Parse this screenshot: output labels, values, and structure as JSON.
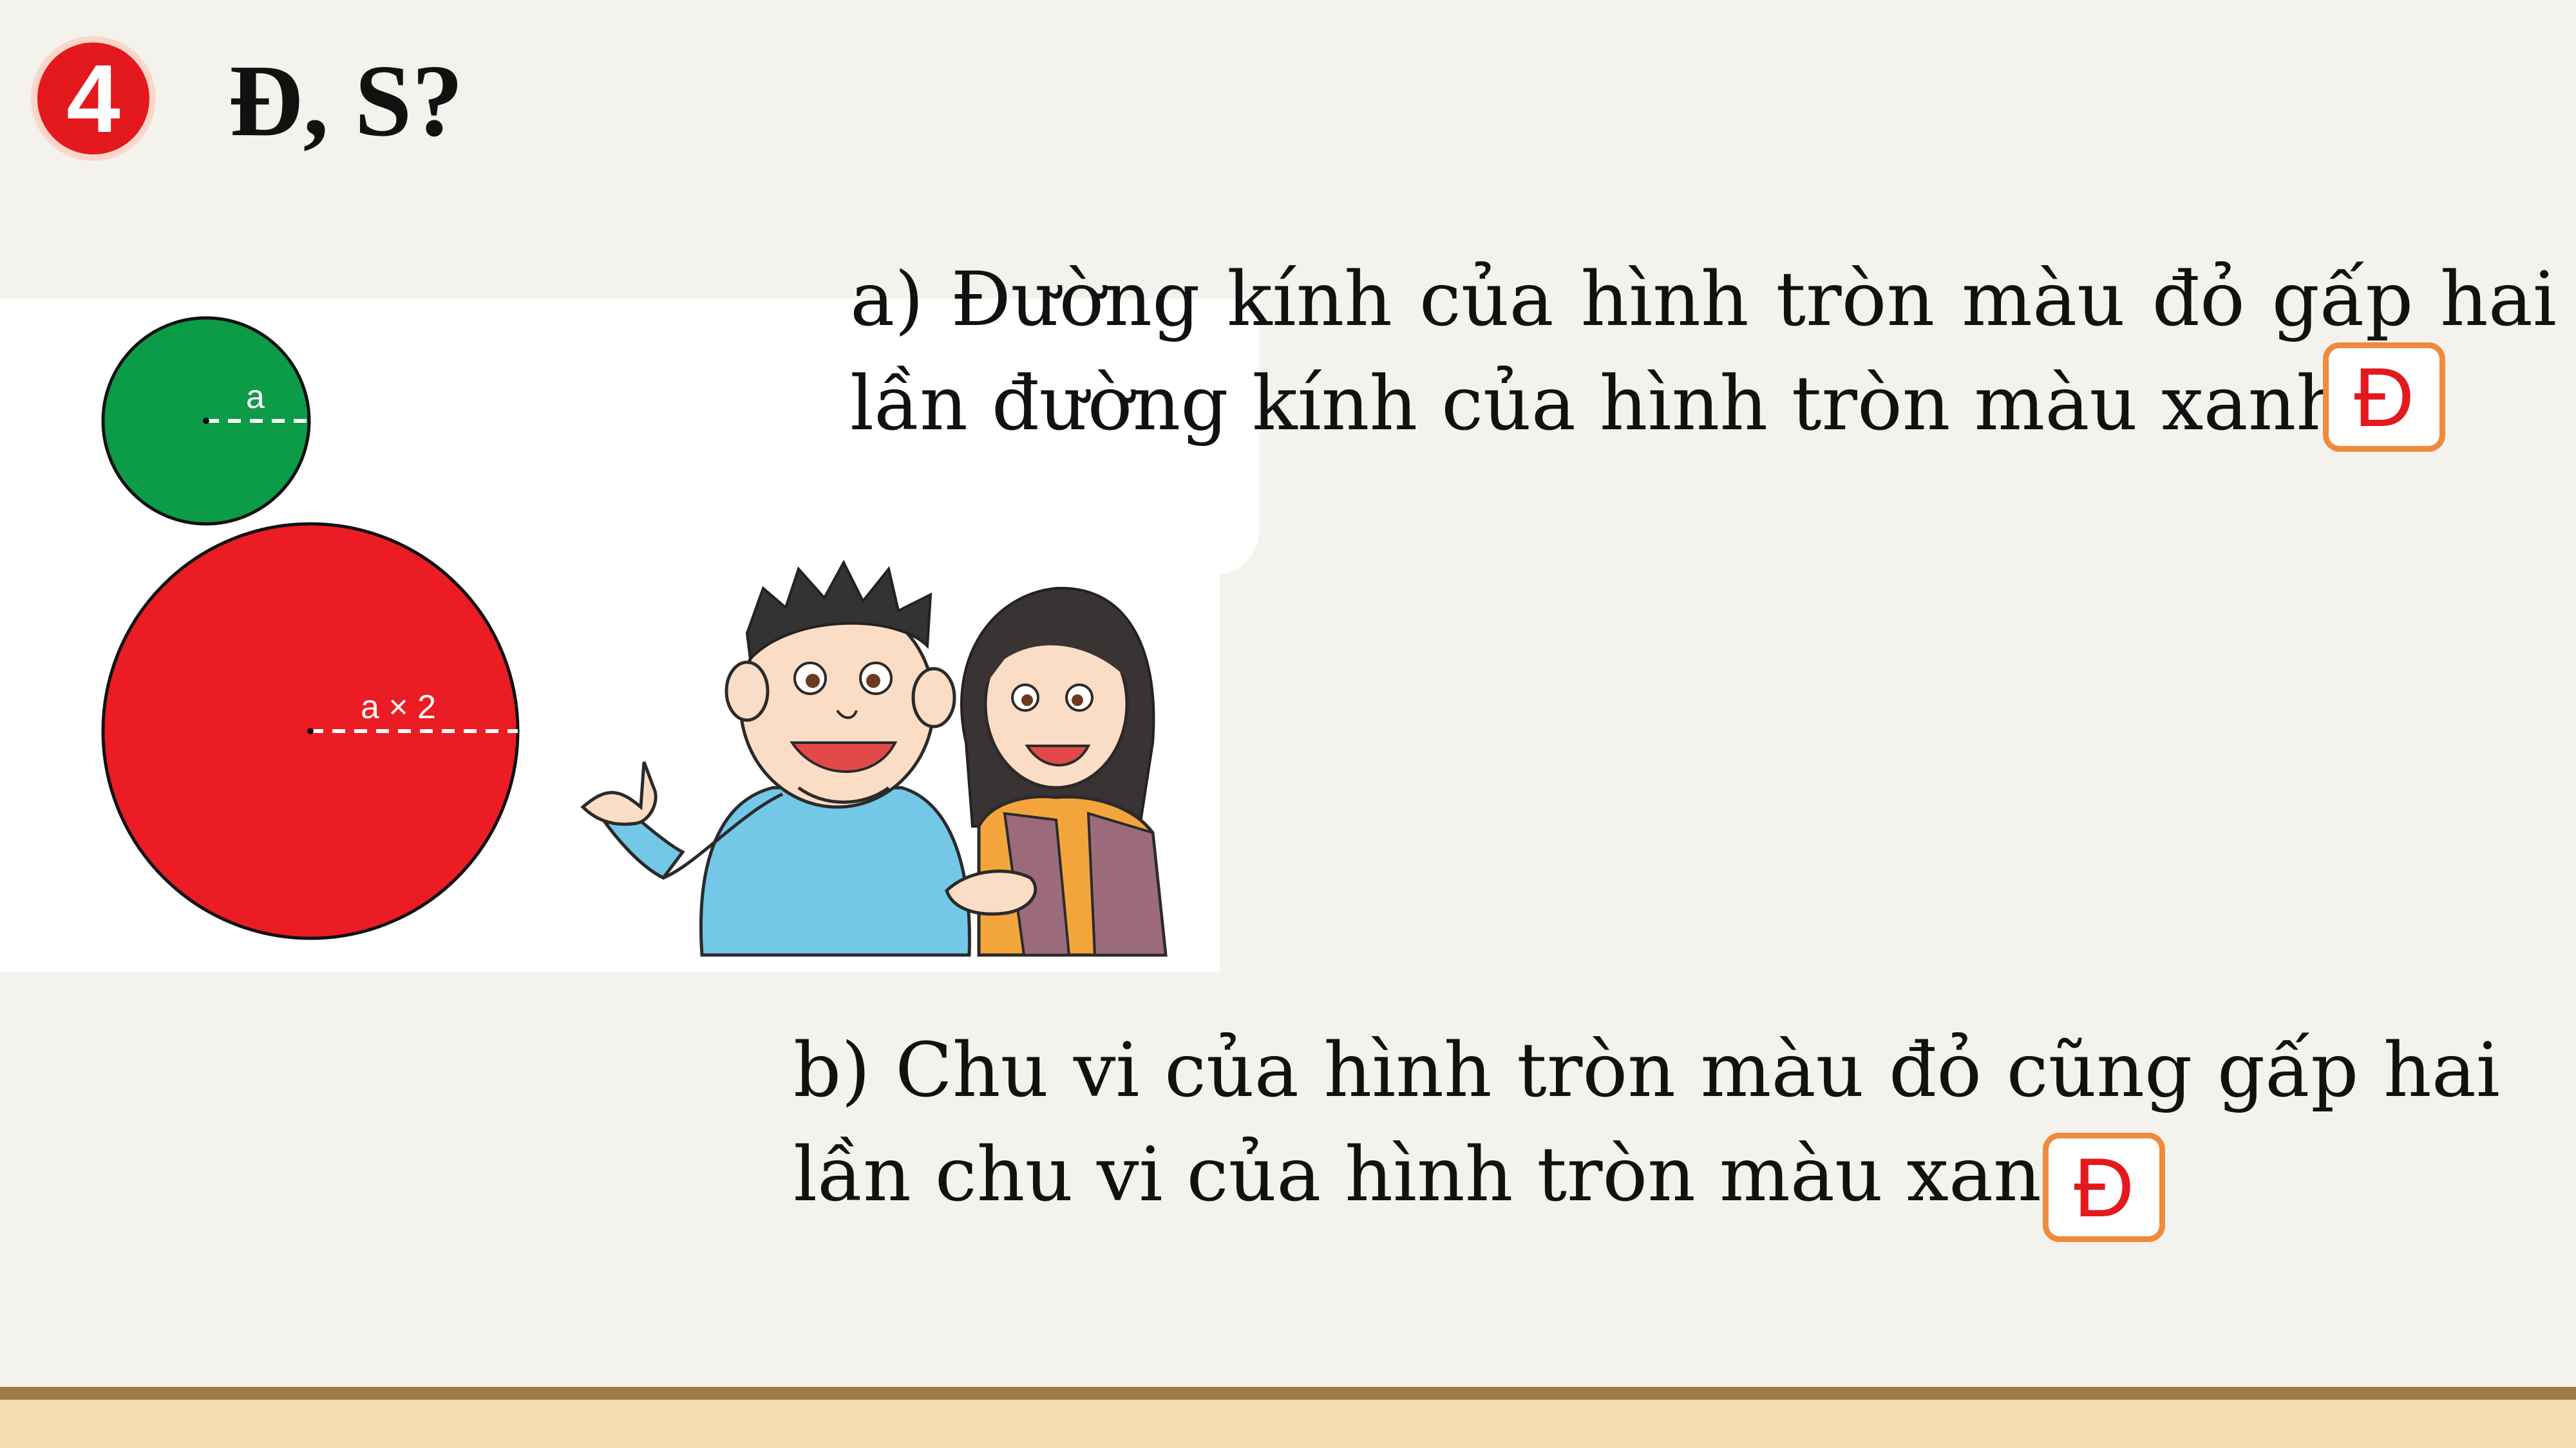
{
  "header": {
    "number": "4",
    "title": "Đ, S?"
  },
  "figure": {
    "small_circle_label": "a",
    "large_circle_label": "a × 2",
    "colors": {
      "small_circle": "#0c9b47",
      "large_circle": "#ec1c24"
    }
  },
  "questions": [
    {
      "text": "a) Đường kính của hình tròn màu đỏ gấp hai lần đường kính của hình tròn màu xanh.",
      "answer": "Đ"
    },
    {
      "text": "b) Chu vi của hình tròn màu đỏ cũng gấp hai lần chu vi của hình tròn màu xanh",
      "answer": "Đ"
    }
  ]
}
